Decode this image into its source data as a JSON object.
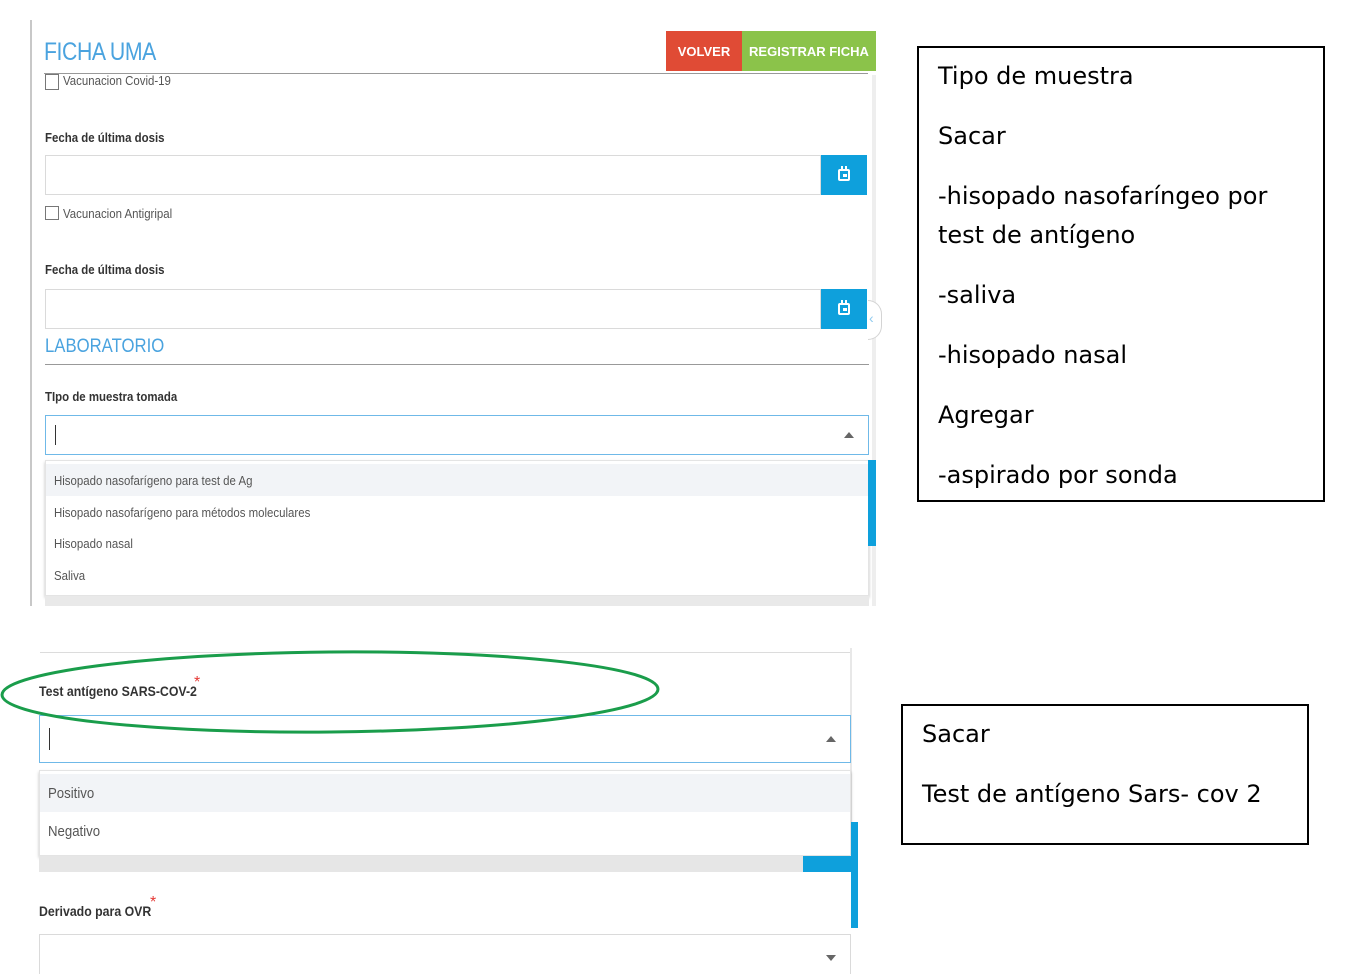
{
  "form": {
    "title": "FICHA UMA",
    "volver_label": "VOLVER",
    "registrar_label": "REGISTRAR FICHA",
    "covid_vaccine_label": "Vacunacion Covid-19",
    "last_dose_label": "Fecha de última dosis",
    "flu_vaccine_label": "Vacunacion Antigripal",
    "last_dose_label_2": "Fecha de última dosis",
    "lab_section_title": "LABORATORIO",
    "sample_type_label": "TIpo de muestra tomada",
    "sample_options": [
      "Hisopado nasofarígeno para test de Ag",
      "Hisopado nasofarígeno para métodos moleculares",
      "Hisopado nasal",
      "Saliva"
    ],
    "antigen_test_label": "Test antígeno SARS-COV-2",
    "required_mark": "*",
    "antigen_options": [
      "Positivo",
      "Negativo"
    ],
    "ovr_label": "Derivado para OVR"
  },
  "notes": {
    "sample_note": [
      "Tipo de muestra",
      "Sacar",
      "-hisopado nasofaríngeo por",
      "test de antígeno",
      "-saliva",
      "-hisopado nasal",
      "Agregar",
      "-aspirado por sonda"
    ],
    "antigen_note": [
      "Sacar",
      "Test de antígeno Sars- cov 2"
    ]
  },
  "colors": {
    "accent_blue": "#0ea0dc",
    "title_blue": "#4aa3df",
    "volver_red": "#e04b35",
    "registrar_green": "#8bc34a",
    "highlight_ellipse": "#1a9d4b",
    "required_red": "#e53935"
  },
  "icons": [
    "calendar-icon",
    "chevron-up-icon",
    "chevron-down-icon",
    "collapse-chevron-icon"
  ]
}
